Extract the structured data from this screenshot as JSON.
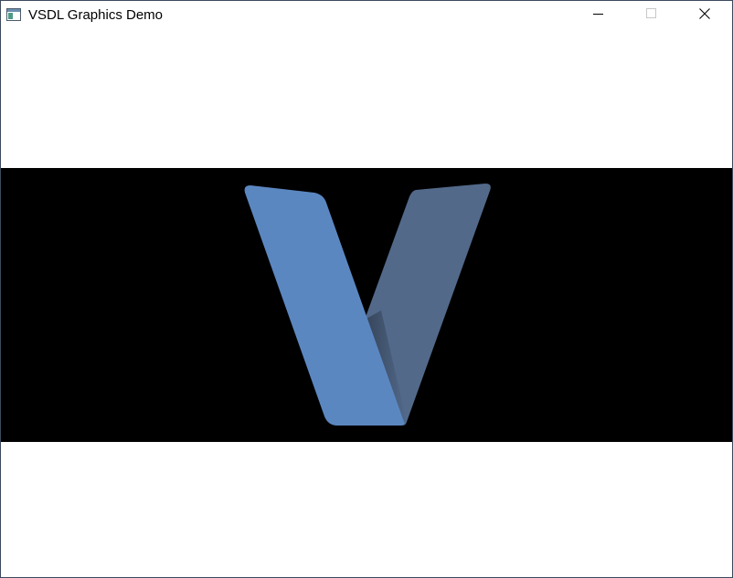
{
  "window": {
    "title": "VSDL Graphics Demo"
  },
  "icons": {
    "app": "window-app-icon",
    "minimize": "minimize-icon",
    "maximize": "maximize-icon",
    "close": "close-icon",
    "logo": "v-logo"
  },
  "colors": {
    "letterbox": "#000000",
    "logo_front": "#5b87c1",
    "logo_back": "#52698a",
    "background": "#ffffff"
  }
}
